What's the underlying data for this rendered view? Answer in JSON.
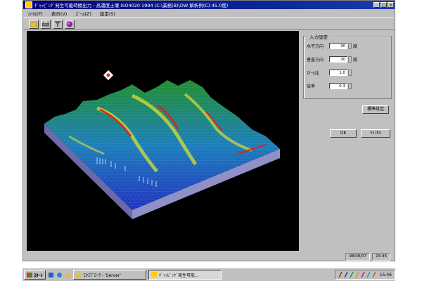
{
  "window": {
    "title": "ｷﾞｬｯﾋﾟﾝｸﾞ発生可能時間出力 - 高濃度土壌 ISO4020 1994 (C:\\業務(B)\\DW 解析例(C)-45.0度)",
    "controls": [
      "_",
      "□",
      "×"
    ]
  },
  "menu": [
    "ﾌｧｲﾙ(F)",
    "表示(V)",
    "ｽﾞｰﾑ(Z)",
    "設定(S)"
  ],
  "toolbar": {
    "icons": [
      "open-folder-icon",
      "print-icon",
      "filter-icon",
      "globe-icon"
    ]
  },
  "settings": {
    "group_title": "入力設定",
    "fields": [
      {
        "label": "水平方向",
        "value": "30",
        "unit": "度"
      },
      {
        "label": "垂直方向",
        "value": "30",
        "unit": "度"
      },
      {
        "label": "ｽｹｰﾙ比",
        "value": "1.0",
        "unit": ""
      },
      {
        "label": "倍率",
        "value": "0.3",
        "unit": ""
      }
    ],
    "default_button": "標準設定",
    "ok_button": "OK",
    "cancel_button": "ｷｬﾝｾﾙ"
  },
  "status": {
    "date": "98/08/07",
    "time": "15:46"
  },
  "taskbar": {
    "start_label": "ｽﾀｰﾄ",
    "tasks": [
      {
        "label": "ｴｸｽﾌﾟﾛｰﾗ - 'Server'",
        "active": false
      },
      {
        "label": "ｷﾞｬｯﾋﾟﾝｸﾞ発生可能...",
        "active": true
      }
    ],
    "clock": "15:46"
  },
  "colors": {
    "title_bar": "#00007b",
    "window_face": "#c0c0c0",
    "viewport_bg": "#000000",
    "terrain_high": "#e02020",
    "terrain_mid": "#20c040",
    "terrain_low": "#2040d0"
  }
}
